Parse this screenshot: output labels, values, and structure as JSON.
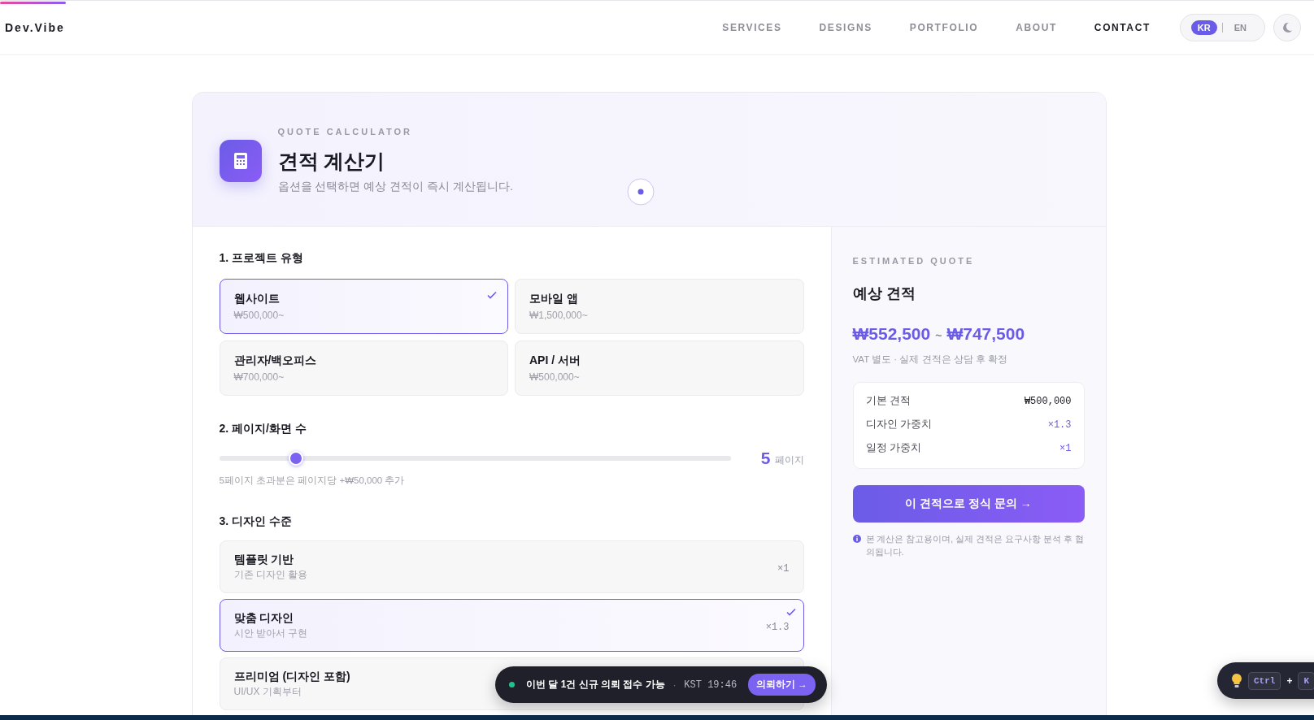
{
  "header": {
    "logo": "Dev.Vibe",
    "progress": {
      "level": 0.05
    },
    "nav": [
      {
        "label": "SERVICES",
        "selected": false
      },
      {
        "label": "DESIGNS",
        "selected": false
      },
      {
        "label": "PORTFOLIO",
        "selected": false
      },
      {
        "label": "ABOUT",
        "selected": false
      },
      {
        "label": "CONTACT",
        "selected": true
      }
    ],
    "languages": [
      {
        "label": "KR",
        "selected": true
      },
      {
        "label": "EN",
        "selected": false
      }
    ]
  },
  "calculator": {
    "eyebrow": "QUOTE CALCULATOR",
    "title": "견적 계산기",
    "subtitle": "옵션을 선택하면 예상 견적이 즉시 계산됩니다.",
    "sections": {
      "project_type": "1. 프로젝트 유형",
      "pages": "2. 페이지/화면 수",
      "design": "3. 디자인 수준"
    },
    "project_types": [
      {
        "name": "웹사이트",
        "price": "₩500,000~",
        "selected": true
      },
      {
        "name": "모바일 앱",
        "price": "₩1,500,000~",
        "selected": false
      },
      {
        "name": "관리자/백오피스",
        "price": "₩700,000~",
        "selected": false
      },
      {
        "name": "API / 서버",
        "price": "₩500,000~",
        "selected": false
      }
    ],
    "pages": {
      "level": 0.15,
      "value": "5",
      "unit": "페이지",
      "hint": "5페이지 초과분은 페이지당 +₩50,000 추가"
    },
    "designs": [
      {
        "name": "템플릿 기반",
        "desc": "기존 디자인 활용",
        "multiplier": "×1",
        "selected": false
      },
      {
        "name": "맞춤 디자인",
        "desc": "시안 받아서 구현",
        "multiplier": "×1.3",
        "selected": true
      },
      {
        "name": "프리미엄 (디자인 포함)",
        "desc": "UI/UX 기획부터",
        "selected": false
      }
    ]
  },
  "quote": {
    "eyebrow": "ESTIMATED QUOTE",
    "title": "예상 견적",
    "min": "₩552,500",
    "separator": "~",
    "max": "₩747,500",
    "note": "VAT 별도 · 실제 견적은 상담 후 확정",
    "breakdown": [
      {
        "label": "기본 견적",
        "value": "₩500,000",
        "kind": "amount"
      },
      {
        "label": "디자인 가중치",
        "value": "×1.3",
        "kind": "multiplier"
      },
      {
        "label": "일정 가중치",
        "value": "×1",
        "kind": "multiplier"
      }
    ],
    "button": "이 견적으로 정식 문의 →",
    "disclaimer": "본 계산은 참고용이며, 실제 견적은 요구사항 분석 후 협의됩니다."
  },
  "status_toast": {
    "message": "이번 달 1건 신규 의뢰 접수 가능",
    "separator": "·",
    "time": "KST 19:46",
    "button": "의뢰하기 →"
  },
  "shortcut_toast": {
    "keys": [
      "Ctrl",
      "K"
    ],
    "plus": "+"
  }
}
